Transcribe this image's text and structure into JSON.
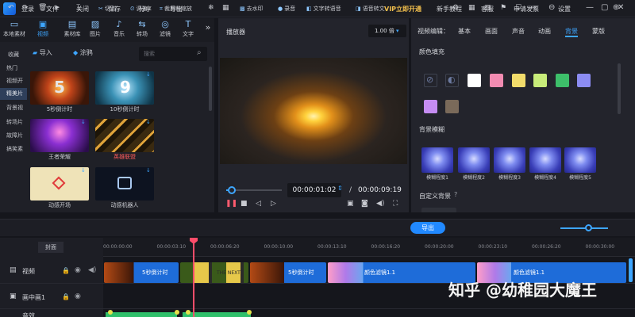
{
  "menubar": {
    "items": [
      "登录",
      "文件",
      "关闭",
      "保存",
      "分享",
      "导出"
    ],
    "vip": "VIP立即开通",
    "right_items": [
      "新手教程",
      "客服",
      "申请发票",
      "设置"
    ],
    "window_controls": [
      "—",
      "▢",
      "✕"
    ]
  },
  "library": {
    "tabs": [
      "本地素材",
      "视频",
      "素材库",
      "图片",
      "音乐",
      "转场",
      "滤镜",
      "文字"
    ],
    "active_tab": "视频",
    "more": "»",
    "import_label": "导入",
    "paint_label": "涂鸦",
    "search_placeholder": "搜索",
    "categories": [
      "收藏",
      "热门",
      "视频开",
      "精美片",
      "背景视",
      "转场片",
      "故障片",
      "搞笑素"
    ],
    "active_category": "精美片",
    "items": [
      {
        "caption": "5秒倒计时",
        "overlay": "5"
      },
      {
        "caption": "10秒倒计时",
        "overlay": "9"
      },
      {
        "caption": "王者荣耀",
        "overlay": ""
      },
      {
        "caption": "英雄联盟",
        "overlay": ""
      },
      {
        "caption": "动感开场",
        "overlay": ""
      },
      {
        "caption": "动感机器人",
        "overlay": ""
      }
    ]
  },
  "player": {
    "title": "播放器",
    "speed": "1.00 倍",
    "current_time": "00:00:01:02",
    "separator": "/",
    "total_time": "00:00:09:19",
    "progress_fraction": 0.1
  },
  "editor": {
    "tabs": [
      "视频编辑：",
      "基本",
      "画面",
      "声音",
      "动画",
      "背景",
      "蒙版"
    ],
    "active_tab": "背景",
    "color_fill_label": "颜色填充",
    "swatches": [
      "#ffffff",
      "#f28cb2",
      "#f2dc6b",
      "#c8ec7a",
      "#3dbf6a",
      "#8c8cf2",
      "#c58cf2",
      "#7a6a5a"
    ],
    "blur_label": "背景模糊",
    "blur_items": [
      "模糊程度1",
      "模糊程度2",
      "模糊程度3",
      "模糊程度4",
      "模糊程度5"
    ],
    "custom_bg_label": "自定义背景"
  },
  "timeline": {
    "tools": [
      "切割",
      "调速",
      "裁剪和缩放",
      "去水印",
      "录音",
      "文字转语音",
      "语音转文"
    ],
    "export_label": "导出",
    "cover_label": "封面",
    "ruler": [
      "00:00:00:00",
      "00:00:03:10",
      "00:00:06:20",
      "00:00:10:00",
      "00:00:13:10",
      "00:00:16:20",
      "00:00:20:00",
      "00:00:23:10",
      "00:00:26:20",
      "00:00:30:00",
      "00:00:33:1"
    ],
    "tracks": [
      {
        "label": "视频"
      },
      {
        "label": "画中画1"
      },
      {
        "label": "音效"
      }
    ],
    "clips": [
      {
        "label": "5秒倒计时"
      },
      {
        "label": "THE NEXT"
      },
      {
        "label": "5秒倒计时"
      },
      {
        "label": "颜色滤镜1.1"
      },
      {
        "label": "颜色滤镜1.1"
      }
    ]
  },
  "watermark": "知乎 @幼稚园大魔王"
}
